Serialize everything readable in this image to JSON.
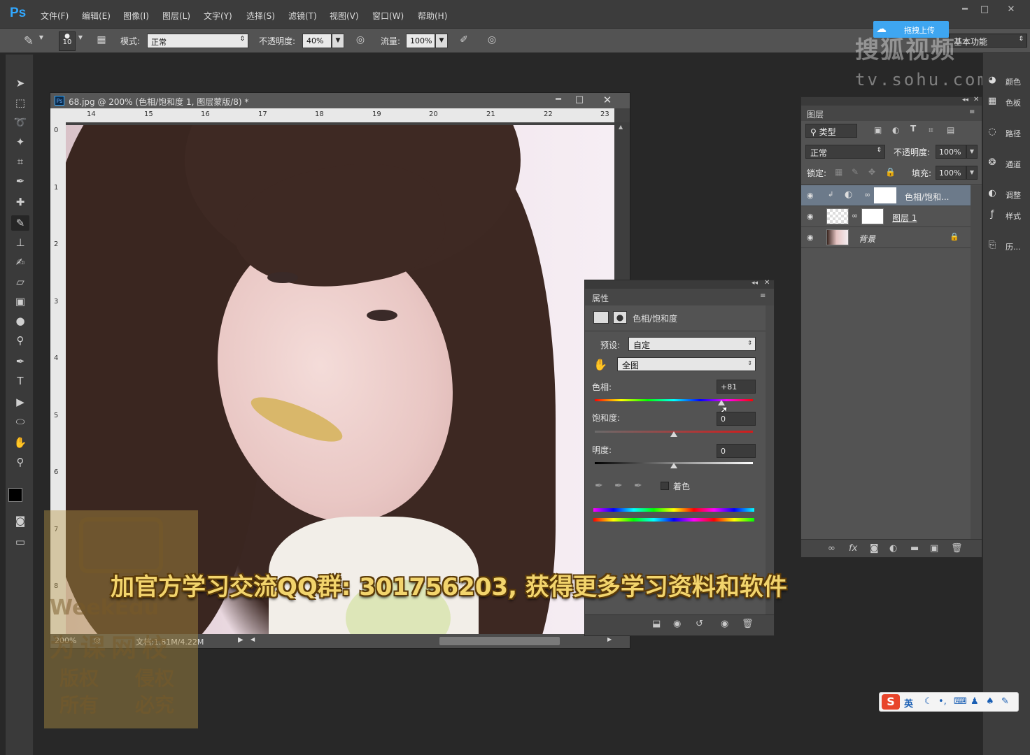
{
  "app": {
    "logo": "Ps"
  },
  "menu": [
    "文件(F)",
    "编辑(E)",
    "图像(I)",
    "图层(L)",
    "文字(Y)",
    "选择(S)",
    "滤镜(T)",
    "视图(V)",
    "窗口(W)",
    "帮助(H)"
  ],
  "options": {
    "brush_size": "10",
    "mode_label": "模式:",
    "mode_value": "正常",
    "opacity_label": "不透明度:",
    "opacity_value": "40%",
    "flow_label": "流量:",
    "flow_value": "100%"
  },
  "workspace": {
    "value": "基本功能"
  },
  "watermark": {
    "upload_label": "拖拽上传",
    "sohu": "搜狐视频",
    "sohu_url": "tv.sohu.com",
    "weekedu": "WeekEdu",
    "edu_cn": "为课网校",
    "rights_left": [
      "版权",
      "所有"
    ],
    "rights_right": [
      "侵权",
      "必究"
    ]
  },
  "document": {
    "title": "68.jpg @ 200% (色相/饱和度 1, 图层蒙版/8) *",
    "ruler_top": [
      "14",
      "15",
      "16",
      "17",
      "18",
      "19",
      "20",
      "21",
      "22",
      "23"
    ],
    "ruler_left": [
      "0",
      "1",
      "2",
      "3",
      "4",
      "5",
      "6",
      "7",
      "8"
    ],
    "zoom": "200%",
    "doc_info": "文档:1.81M/4.22M"
  },
  "subtitle": "加官方学习交流QQ群: 301756203, 获得更多学习资料和软件",
  "properties": {
    "tab": "属性",
    "title": "色相/饱和度",
    "preset_label": "预设:",
    "preset_value": "自定",
    "range_value": "全图",
    "hue_label": "色相:",
    "hue_value": "+81",
    "hue_fraction": 0.8,
    "saturation_label": "饱和度:",
    "saturation_value": "0",
    "saturation_fraction": 0.5,
    "lightness_label": "明度:",
    "lightness_value": "0",
    "lightness_fraction": 0.5,
    "colorize_label": "着色"
  },
  "layers": {
    "tab": "图层",
    "kind_label": "类型",
    "blend_mode": "正常",
    "opacity_label": "不透明度:",
    "opacity_value": "100%",
    "lock_label": "锁定:",
    "fill_label": "填充:",
    "fill_value": "100%",
    "items": [
      {
        "name": "色相/饱和...",
        "selected": true
      },
      {
        "name": "图层 1",
        "selected": false
      },
      {
        "name": "背景",
        "selected": false
      }
    ]
  },
  "dock": [
    {
      "icon": "palette-icon",
      "label": "颜色"
    },
    {
      "icon": "swatches-icon",
      "label": "色板"
    },
    {
      "icon": "paths-icon",
      "label": "路径"
    },
    {
      "icon": "channels-icon",
      "label": "通道"
    },
    {
      "icon": "adjustments-icon",
      "label": "调整"
    },
    {
      "icon": "styles-icon",
      "label": "样式"
    },
    {
      "icon": "history-icon",
      "label": "历..."
    }
  ],
  "ime": {
    "label": "英"
  },
  "colors": {
    "accent": "#31a8ff",
    "panel": "#535353",
    "subtitle": "#f2d46c",
    "selected_layer": "#6c7a8a"
  }
}
